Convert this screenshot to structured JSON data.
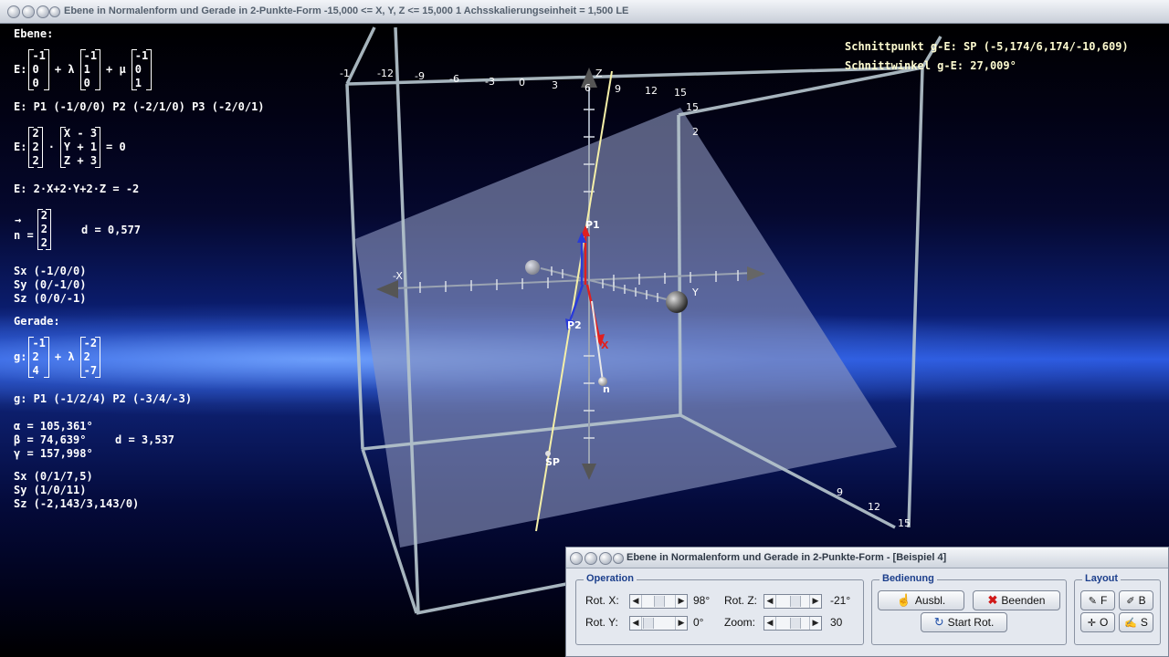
{
  "window": {
    "title": "Ebene in Normalenform und Gerade in 2-Punkte-Form   -15,000 <= X, Y, Z <= 15,000   1 Achsskalierungseinheit = 1,500 LE"
  },
  "info": {
    "ebene_heading": "Ebene:",
    "param_prefix": "E:",
    "param_v0": [
      "-1",
      "0",
      "0"
    ],
    "plus_lambda": "+ λ",
    "param_v1": [
      "-1",
      "1",
      "0"
    ],
    "plus_mu": "+ μ",
    "param_v2": [
      "-1",
      "0",
      "1"
    ],
    "points_line": "E: P1 (-1/0/0)    P2 (-2/1/0)    P3 (-2/0/1)",
    "normal_prefix": "E:",
    "normal_vec": [
      "2",
      "2",
      "2"
    ],
    "dot": "·",
    "normal_xyz": [
      "X - 3",
      "Y + 1",
      "Z + 3"
    ],
    "eq_zero": "= 0",
    "coord_eq": "E: 2·X+2·Y+2·Z = -2",
    "n_arrow": "→",
    "n_label": "n =",
    "n_vec": [
      "2",
      "2",
      "2"
    ],
    "d_plane": "d = 0,577",
    "sx": "Sx (-1/0/0)",
    "sy": "Sy (0/-1/0)",
    "sz": "Sz (0/0/-1)",
    "gerade_heading": "Gerade:",
    "g_prefix": "g:",
    "g_v0": [
      "-1",
      "2",
      "4"
    ],
    "g_plus_lambda": "+ λ",
    "g_v1": [
      "-2",
      "2",
      "-7"
    ],
    "g_points": "g: P1 (-1/2/4)    P2 (-3/4/-3)",
    "alpha": "α = 105,361°",
    "beta": "β = 74,639°",
    "gamma": "γ = 157,998°",
    "d_line": "d = 3,537",
    "gsx": "Sx (0/1/7,5)",
    "gsy": "Sy (1/0/11)",
    "gsz": "Sz (-2,143/3,143/0)"
  },
  "result": {
    "schnittpunkt": "Schnittpunkt g-E: SP (-5,174/6,174/-10,609)",
    "schnittwinkel": "Schnittwinkel g-E: 27,009°"
  },
  "scene": {
    "x_ticks": [
      "-1",
      "-12",
      "-9",
      "-6",
      "-3",
      "0",
      "3",
      "6",
      "9",
      "12",
      "15"
    ],
    "right_ticks": [
      "15",
      "2"
    ],
    "bottom_ticks": [
      "9",
      "12",
      "15"
    ],
    "label_z": "Z",
    "label_neg_x": "-X",
    "label_y": "Y",
    "label_x": "X",
    "label_p1": "P1",
    "label_p2": "P2",
    "label_n": "n",
    "label_sp": "SP",
    "colors": {
      "line": "#f5f0a8",
      "plane": "#8c96be",
      "box": "#b5c4cc",
      "red": "#e02020",
      "blue": "#2a3cd8"
    }
  },
  "dialog": {
    "title": "Ebene in Normalenform und Gerade in 2-Punkte-Form - [Beispiel 4]",
    "operation": {
      "label": "Operation",
      "rot_x_label": "Rot. X:",
      "rot_x_value": "98°",
      "rot_y_label": "Rot. Y:",
      "rot_y_value": "0°",
      "rot_z_label": "Rot. Z:",
      "rot_z_value": "-21°",
      "zoom_label": "Zoom:",
      "zoom_value": "30"
    },
    "bedienung": {
      "label": "Bedienung",
      "ausbl": "Ausbl.",
      "beenden": "Beenden",
      "start_rot": "Start Rot."
    },
    "layout": {
      "label": "Layout",
      "f": "F",
      "b": "B",
      "o": "O",
      "s": "S"
    }
  }
}
